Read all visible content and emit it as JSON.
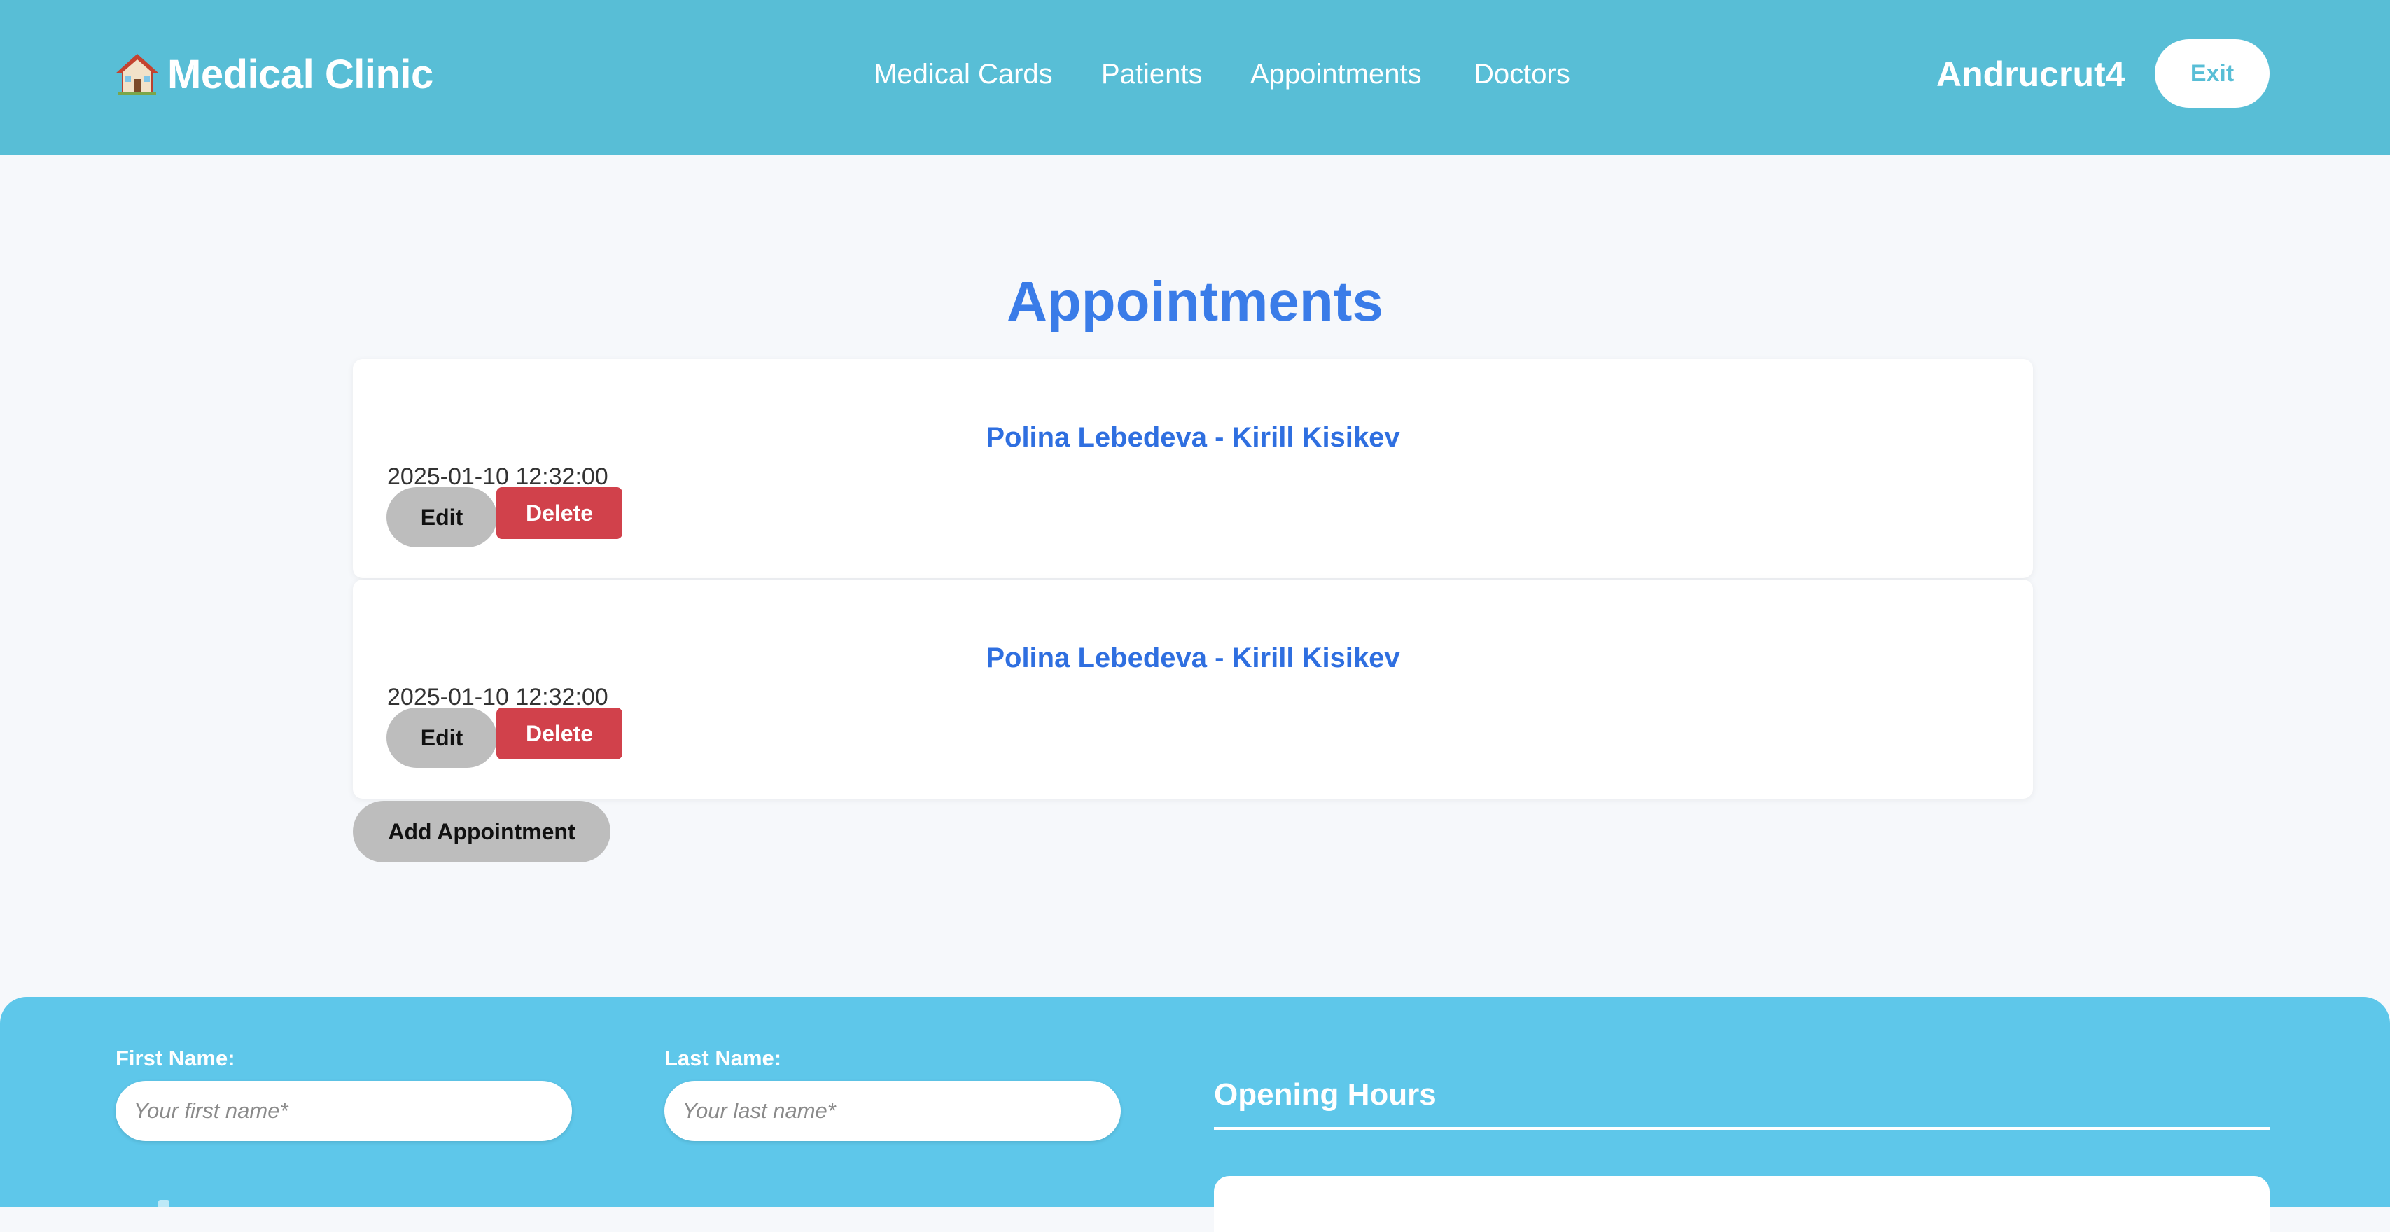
{
  "header": {
    "logo_text": "Medical Clinic",
    "logo_icon": "house-icon",
    "nav": [
      {
        "label": "Medical Cards"
      },
      {
        "label": "Patients"
      },
      {
        "label": "Appointments"
      },
      {
        "label": "Doctors"
      }
    ],
    "user_name": "Andrucrut4",
    "exit_label": "Exit"
  },
  "main": {
    "title": "Appointments",
    "appointments": [
      {
        "title": "Polina Lebedeva - Kirill Kisikev",
        "datetime": "2025-01-10 12:32:00",
        "edit_label": "Edit",
        "delete_label": "Delete"
      },
      {
        "title": "Polina Lebedeva - Kirill Kisikev",
        "datetime": "2025-01-10 12:32:00",
        "edit_label": "Edit",
        "delete_label": "Delete"
      }
    ],
    "add_label": "Add Appointment"
  },
  "footer": {
    "first_name_label": "First Name:",
    "first_name_placeholder": "Your first name*",
    "first_name_value": "",
    "last_name_label": "Last Name:",
    "last_name_placeholder": "Your last name*",
    "last_name_value": "",
    "hours_title": "Opening Hours"
  },
  "colors": {
    "header_bg": "#58bed6",
    "footer_bg": "#5ec7ea",
    "accent_blue": "#3a7ce8",
    "delete_red": "#d1414b",
    "button_grey": "#bdbdbd",
    "page_bg": "#f6f8fb"
  }
}
